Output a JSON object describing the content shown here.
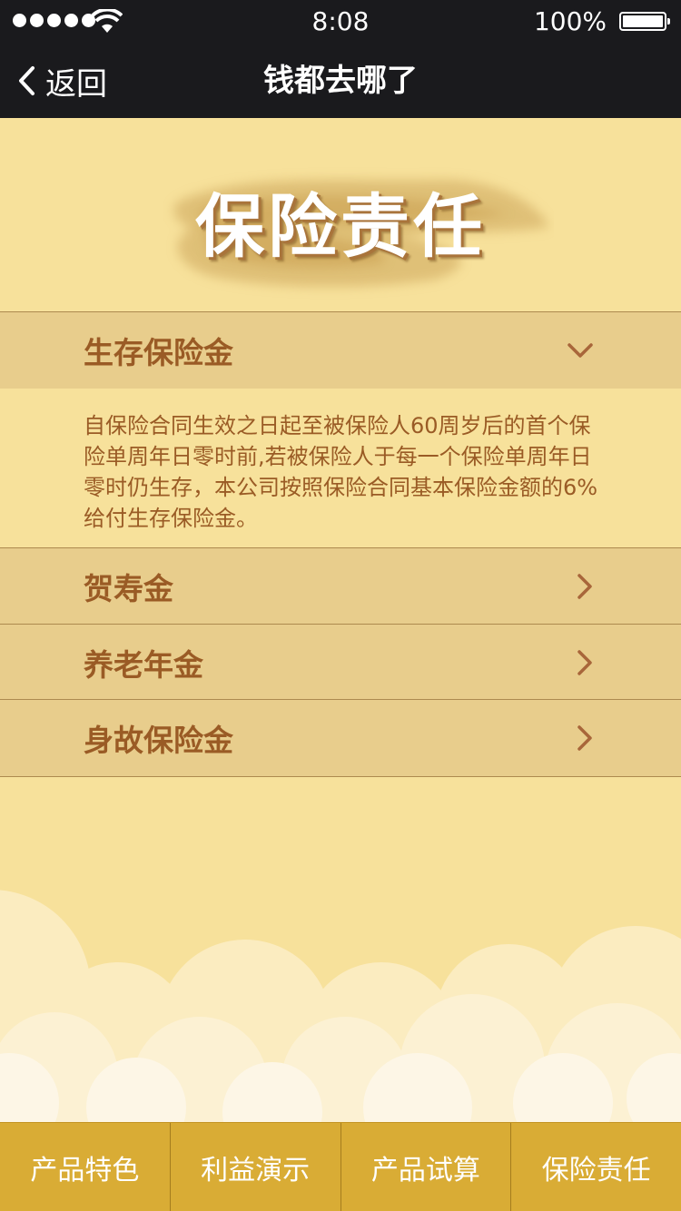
{
  "status_bar": {
    "time": "8:08",
    "battery": "100%"
  },
  "nav": {
    "back_label": "返回",
    "title": "钱都去哪了"
  },
  "banner": {
    "title": "保险责任"
  },
  "sections": [
    {
      "label": "生存保险金",
      "expanded": true,
      "icon": "chevron-down-icon",
      "content": "自保险合同生效之日起至被保险人60周岁后的首个保险单周年日零时前,若被保险人于每一个保险单周年日零时仍生存，本公司按照保险合同基本保险金额的6%给付生存保险金。"
    },
    {
      "label": "贺寿金",
      "expanded": false,
      "icon": "chevron-right-icon"
    },
    {
      "label": "养老年金",
      "expanded": false,
      "icon": "chevron-right-icon"
    },
    {
      "label": "身故保险金",
      "expanded": false,
      "icon": "chevron-right-icon"
    }
  ],
  "tabs": [
    {
      "label": "产品特色"
    },
    {
      "label": "利益演示"
    },
    {
      "label": "产品试算"
    },
    {
      "label": "保险责任"
    }
  ],
  "colors": {
    "background": "#f7e19b",
    "header": "#1a1a1d",
    "row": "#e8cd8c",
    "text_brown": "#9a5b25",
    "tabbar": "#d9ac35"
  }
}
